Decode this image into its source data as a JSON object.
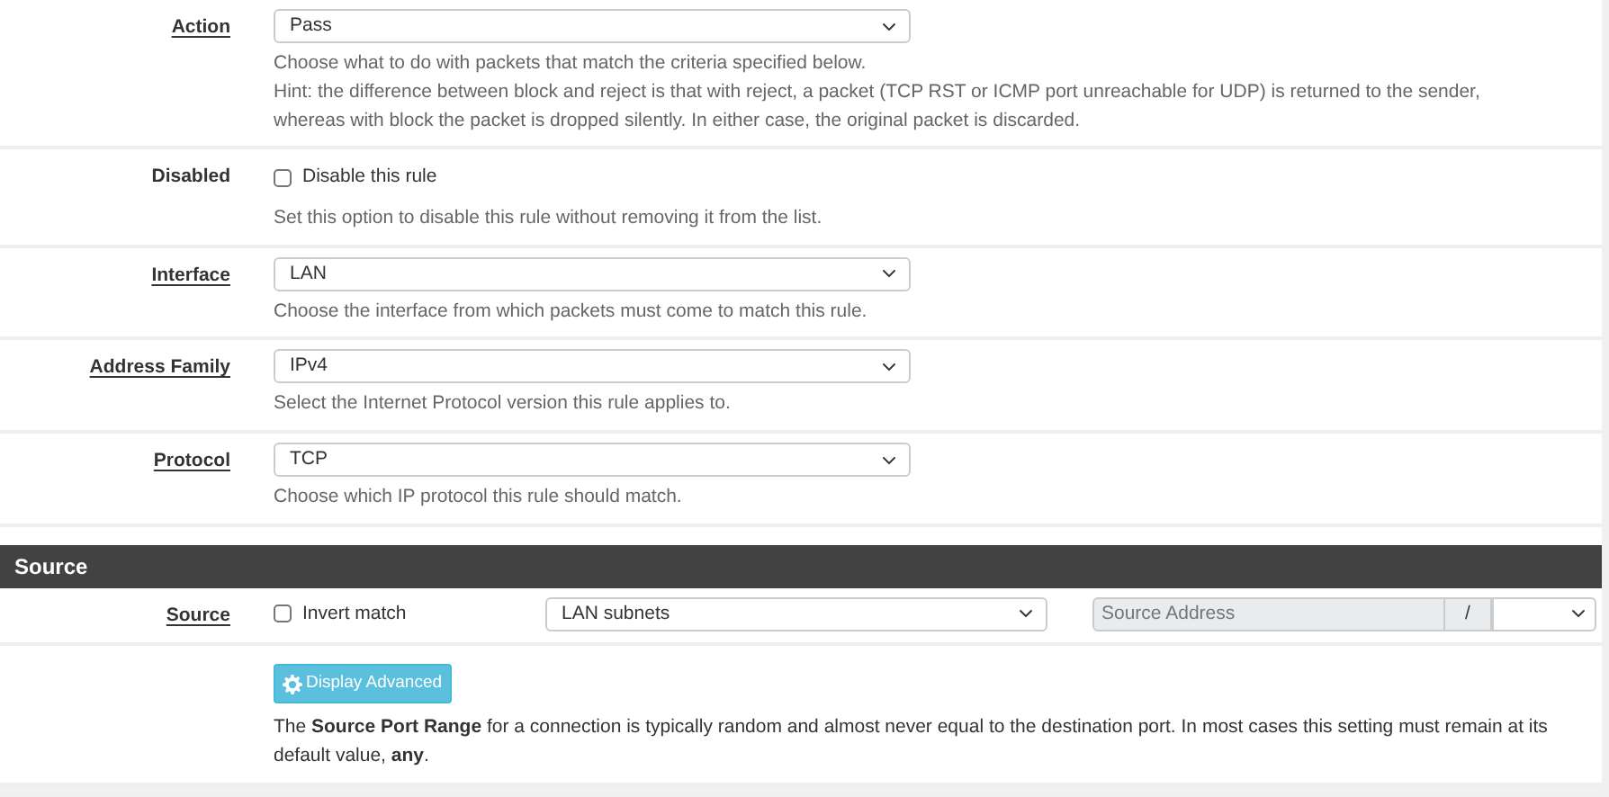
{
  "rows": [
    {
      "kind": "select",
      "label": "Action",
      "value": "Pass",
      "help": [
        "Choose what to do with packets that match the criteria specified below.",
        "Hint: the difference between block and reject is that with reject, a packet (TCP RST or ICMP port unreachable for UDP) is returned to the sender, whereas with block the packet is dropped silently. In either case, the original packet is discarded."
      ]
    },
    {
      "kind": "checkbox",
      "label": "Disabled",
      "option": "Disable this rule",
      "checked": false,
      "help": [
        "Set this option to disable this rule without removing it from the list."
      ]
    },
    {
      "kind": "select",
      "label": "Interface",
      "value": "LAN",
      "help": [
        "Choose the interface from which packets must come to match this rule."
      ]
    },
    {
      "kind": "select",
      "label": "Address Family",
      "value": "IPv4",
      "help": [
        "Select the Internet Protocol version this rule applies to."
      ]
    },
    {
      "kind": "select",
      "label": "Protocol",
      "value": "TCP",
      "help": [
        "Choose which IP protocol this rule should match."
      ]
    }
  ],
  "source": {
    "heading": "Source",
    "label": "Source",
    "invert": {
      "option": "Invert match",
      "checked": false
    },
    "type": "LAN subnets",
    "address": {
      "placeholder": "Source Address"
    },
    "slash": "/",
    "button": "Display Advanced",
    "help": "The **Source Port Range** for a connection is typically random and almost never equal to the destination port. In most cases this setting must remain at its default value, **any**."
  }
}
